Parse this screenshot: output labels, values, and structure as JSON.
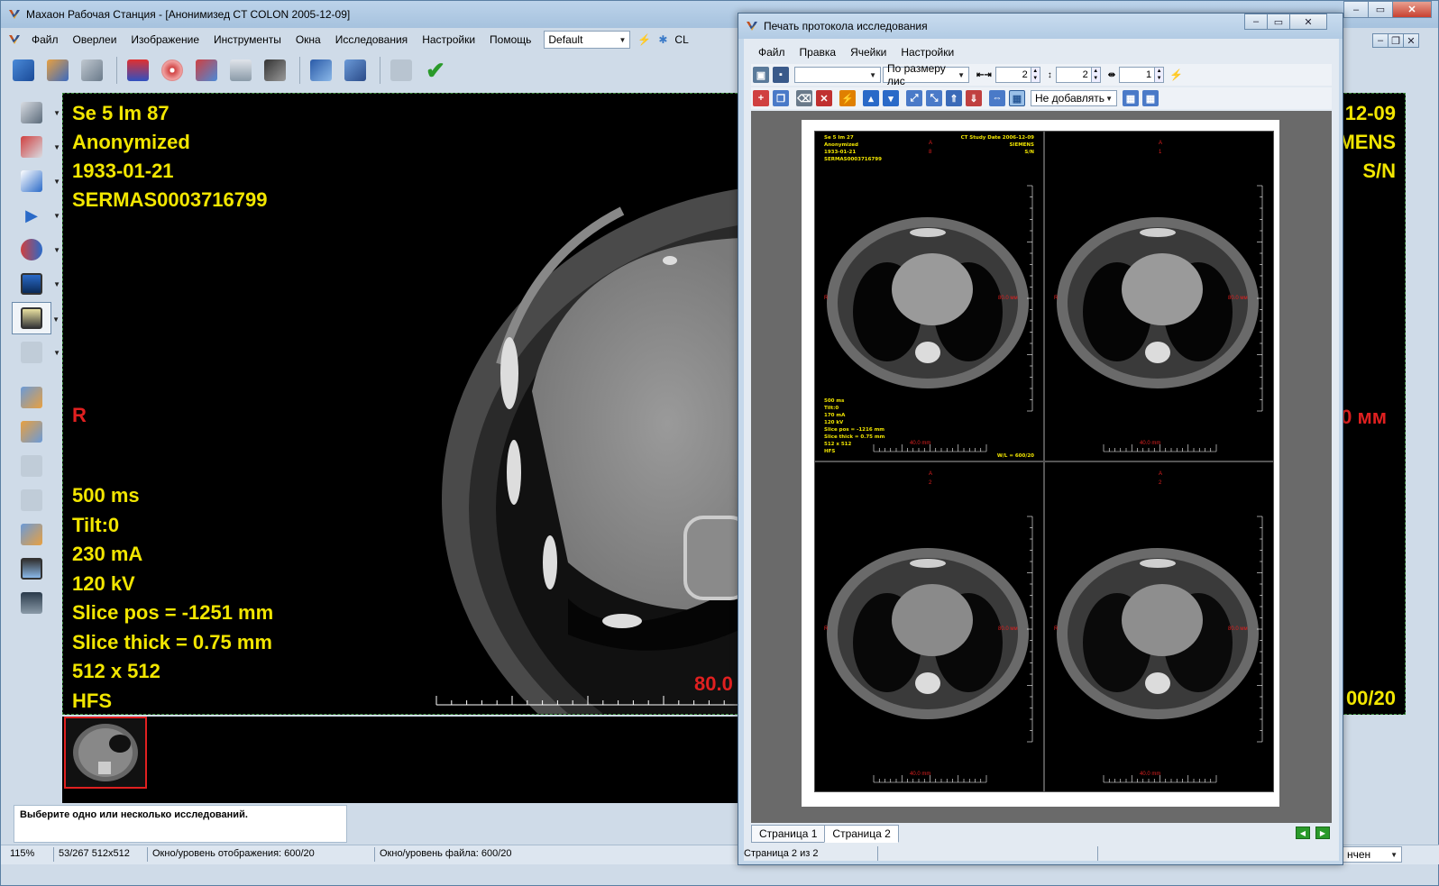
{
  "main": {
    "title": "Махаон Рабочая Станция - [Анонимизед CT COLON 2005-12-09]",
    "menu": [
      "Файл",
      "Оверлеи",
      "Изображение",
      "Инструменты",
      "Окна",
      "Исследования",
      "Настройки",
      "Помощь"
    ],
    "preset": "Default",
    "cl_label": "CL"
  },
  "viewer": {
    "top_left": [
      "Se 5 Im 87",
      " Anonymized",
      "1933-01-21",
      "SERMAS0003716799"
    ],
    "top_right": [
      "12-09",
      "MENS",
      "S/N"
    ],
    "orientation_left": "R",
    "bottom_left": [
      "500 ms",
      "Tilt:0",
      "230 mA",
      "120 kV",
      "Slice pos = -1251 mm",
      "Slice thick = 0.75 mm",
      "512 x 512",
      " HFS"
    ],
    "scale_label": "80.0",
    "right_mm": "0 мм",
    "bottom_right": "00/20"
  },
  "status": {
    "message": "Выберите одно или несколько исследований.",
    "zoom": "115%",
    "image_info": "53/267 512x512",
    "display_window": "Окно/уровень отображения: 600/20",
    "file_window": "Окно/уровень файла: 600/20",
    "right_combo": "нчен"
  },
  "dialog": {
    "title": "Печать протокола исследования",
    "menu": [
      "Файл",
      "Правка",
      "Ячейки",
      "Настройки"
    ],
    "fit_combo": "По размеру лис",
    "rows": "2",
    "cols": "2",
    "copies": "1",
    "add_combo": "Не добавлять",
    "tabs": [
      "Страница 1",
      "Страница 2"
    ],
    "active_tab": 1,
    "page_status": "Страница 2 из 2",
    "cells": [
      {
        "overlay_left": [
          "Se 5 Im 27",
          "Anonymized",
          "1933-01-21",
          "SERMAS0003716799"
        ],
        "overlay_right": [
          "CT Study Date 2006-12-09",
          "SIEMENS",
          "S/N"
        ],
        "top_marker": "A",
        "top_sub": "8",
        "left_marker": "R",
        "mm": "80.0 мм",
        "bottom_left": [
          "500 ms",
          "Tilt:0",
          "170 mA",
          "120 kV",
          "Slice pos = -1216 mm",
          "Slice thick = 0.75 mm",
          "512 x 512",
          "HFS"
        ],
        "bottom_right": "W/L = 600/20",
        "scale": "40.0 mm"
      },
      {
        "top_marker": "A",
        "top_sub": "1",
        "left_marker": "R",
        "mm": "80.0 мм",
        "scale": "40.0 mm"
      },
      {
        "top_marker": "A",
        "top_sub": "2",
        "left_marker": "R",
        "mm": "80.0 мм",
        "scale": "40.0 mm"
      },
      {
        "top_marker": "A",
        "top_sub": "2",
        "left_marker": "R",
        "mm": "80.0 мм",
        "scale": "40.0 mm"
      }
    ]
  }
}
